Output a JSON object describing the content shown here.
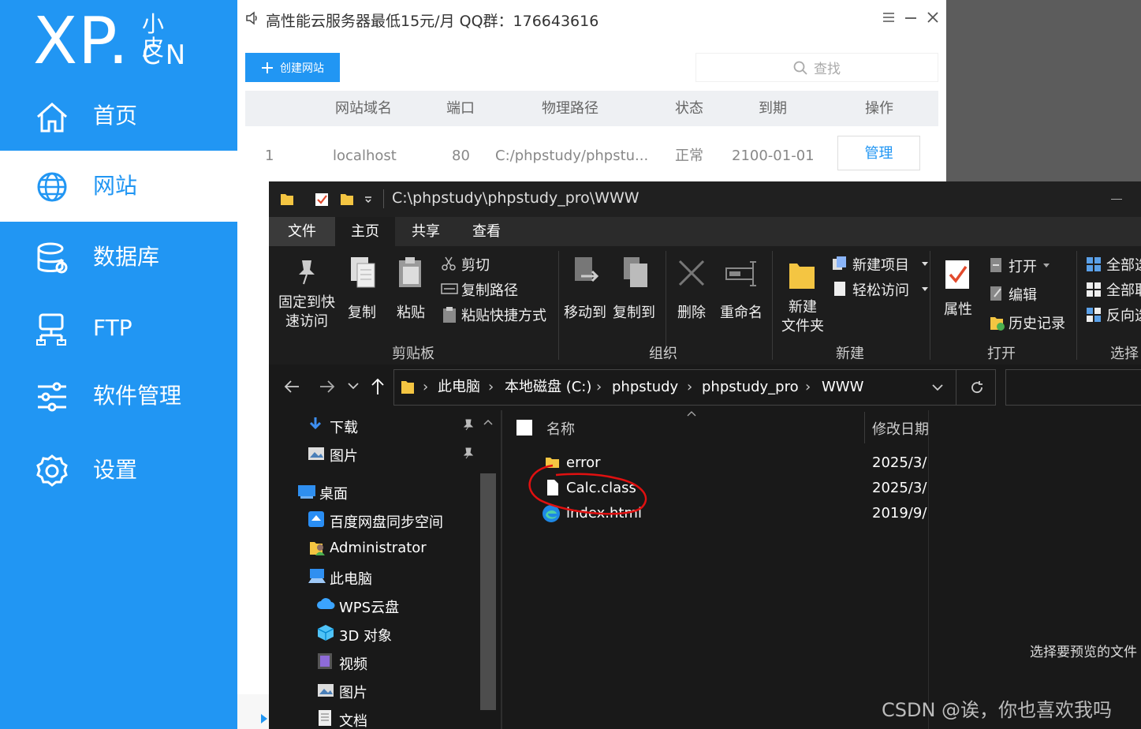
{
  "phpstudy": {
    "logo": {
      "main": "XP",
      "dot": ".",
      "small": "小皮",
      "cn": "CN"
    },
    "nav": [
      {
        "label": "首页",
        "icon": "home-icon"
      },
      {
        "label": "网站",
        "icon": "globe-icon"
      },
      {
        "label": "数据库",
        "icon": "database-icon"
      },
      {
        "label": "FTP",
        "icon": "ftp-icon"
      },
      {
        "label": "软件管理",
        "icon": "sliders-icon"
      },
      {
        "label": "设置",
        "icon": "gear-icon"
      }
    ],
    "announcement": "高性能云服务器最低15元/月 QQ群：176643616",
    "create_button": "创建网站",
    "search_placeholder": "查找",
    "table": {
      "headers": [
        "网站域名",
        "端口",
        "物理路径",
        "状态",
        "到期",
        "操作"
      ],
      "rows": [
        {
          "index": "1",
          "domain": "localhost",
          "port": "80",
          "path": "C:/phpstudy/phpstu...",
          "status": "正常",
          "expire": "2100-01-01",
          "action": "管理"
        }
      ]
    }
  },
  "explorer": {
    "title_path": "C:\\phpstudy\\phpstudy_pro\\WWW",
    "tabs": [
      "文件",
      "主页",
      "共享",
      "查看"
    ],
    "ribbon": {
      "pin": "固定到快\n速访问",
      "copy": "复制",
      "paste": "粘贴",
      "cut": "剪切",
      "copy_path": "复制路径",
      "paste_shortcut": "粘贴快捷方式",
      "clipboard": "剪贴板",
      "move_to": "移动到",
      "copy_to": "复制到",
      "delete": "删除",
      "rename": "重命名",
      "organize": "组织",
      "new_folder": "新建\n文件夹",
      "new_item": "新建项目",
      "easy_access": "轻松访问",
      "new_group": "新建",
      "properties": "属性",
      "open": "打开",
      "edit": "编辑",
      "history": "历史记录",
      "open_group": "打开",
      "select_all": "全部选",
      "select_none": "全部取",
      "invert": "反向选",
      "select_group": "选择"
    },
    "breadcrumb": [
      "此电脑",
      "本地磁盘 (C:)",
      "phpstudy",
      "phpstudy_pro",
      "WWW"
    ],
    "nav_pane": [
      "下载",
      "图片",
      "桌面",
      "百度网盘同步空间",
      "Administrator",
      "此电脑",
      "WPS云盘",
      "3D 对象",
      "视频",
      "图片",
      "文档"
    ],
    "columns": {
      "name": "名称",
      "modified": "修改日期"
    },
    "files": [
      {
        "name": "error",
        "date": "2025/3/"
      },
      {
        "name": "Calc.class",
        "date": "2025/3/"
      },
      {
        "name": "index.html",
        "date": "2019/9/"
      }
    ],
    "preview_text": "选择要预览的文件"
  },
  "watermark": "CSDN @诶，你也喜欢我吗",
  "colors": {
    "accent": "#2196f3",
    "explorer_bg": "#191919",
    "annotation": "#e01010"
  }
}
